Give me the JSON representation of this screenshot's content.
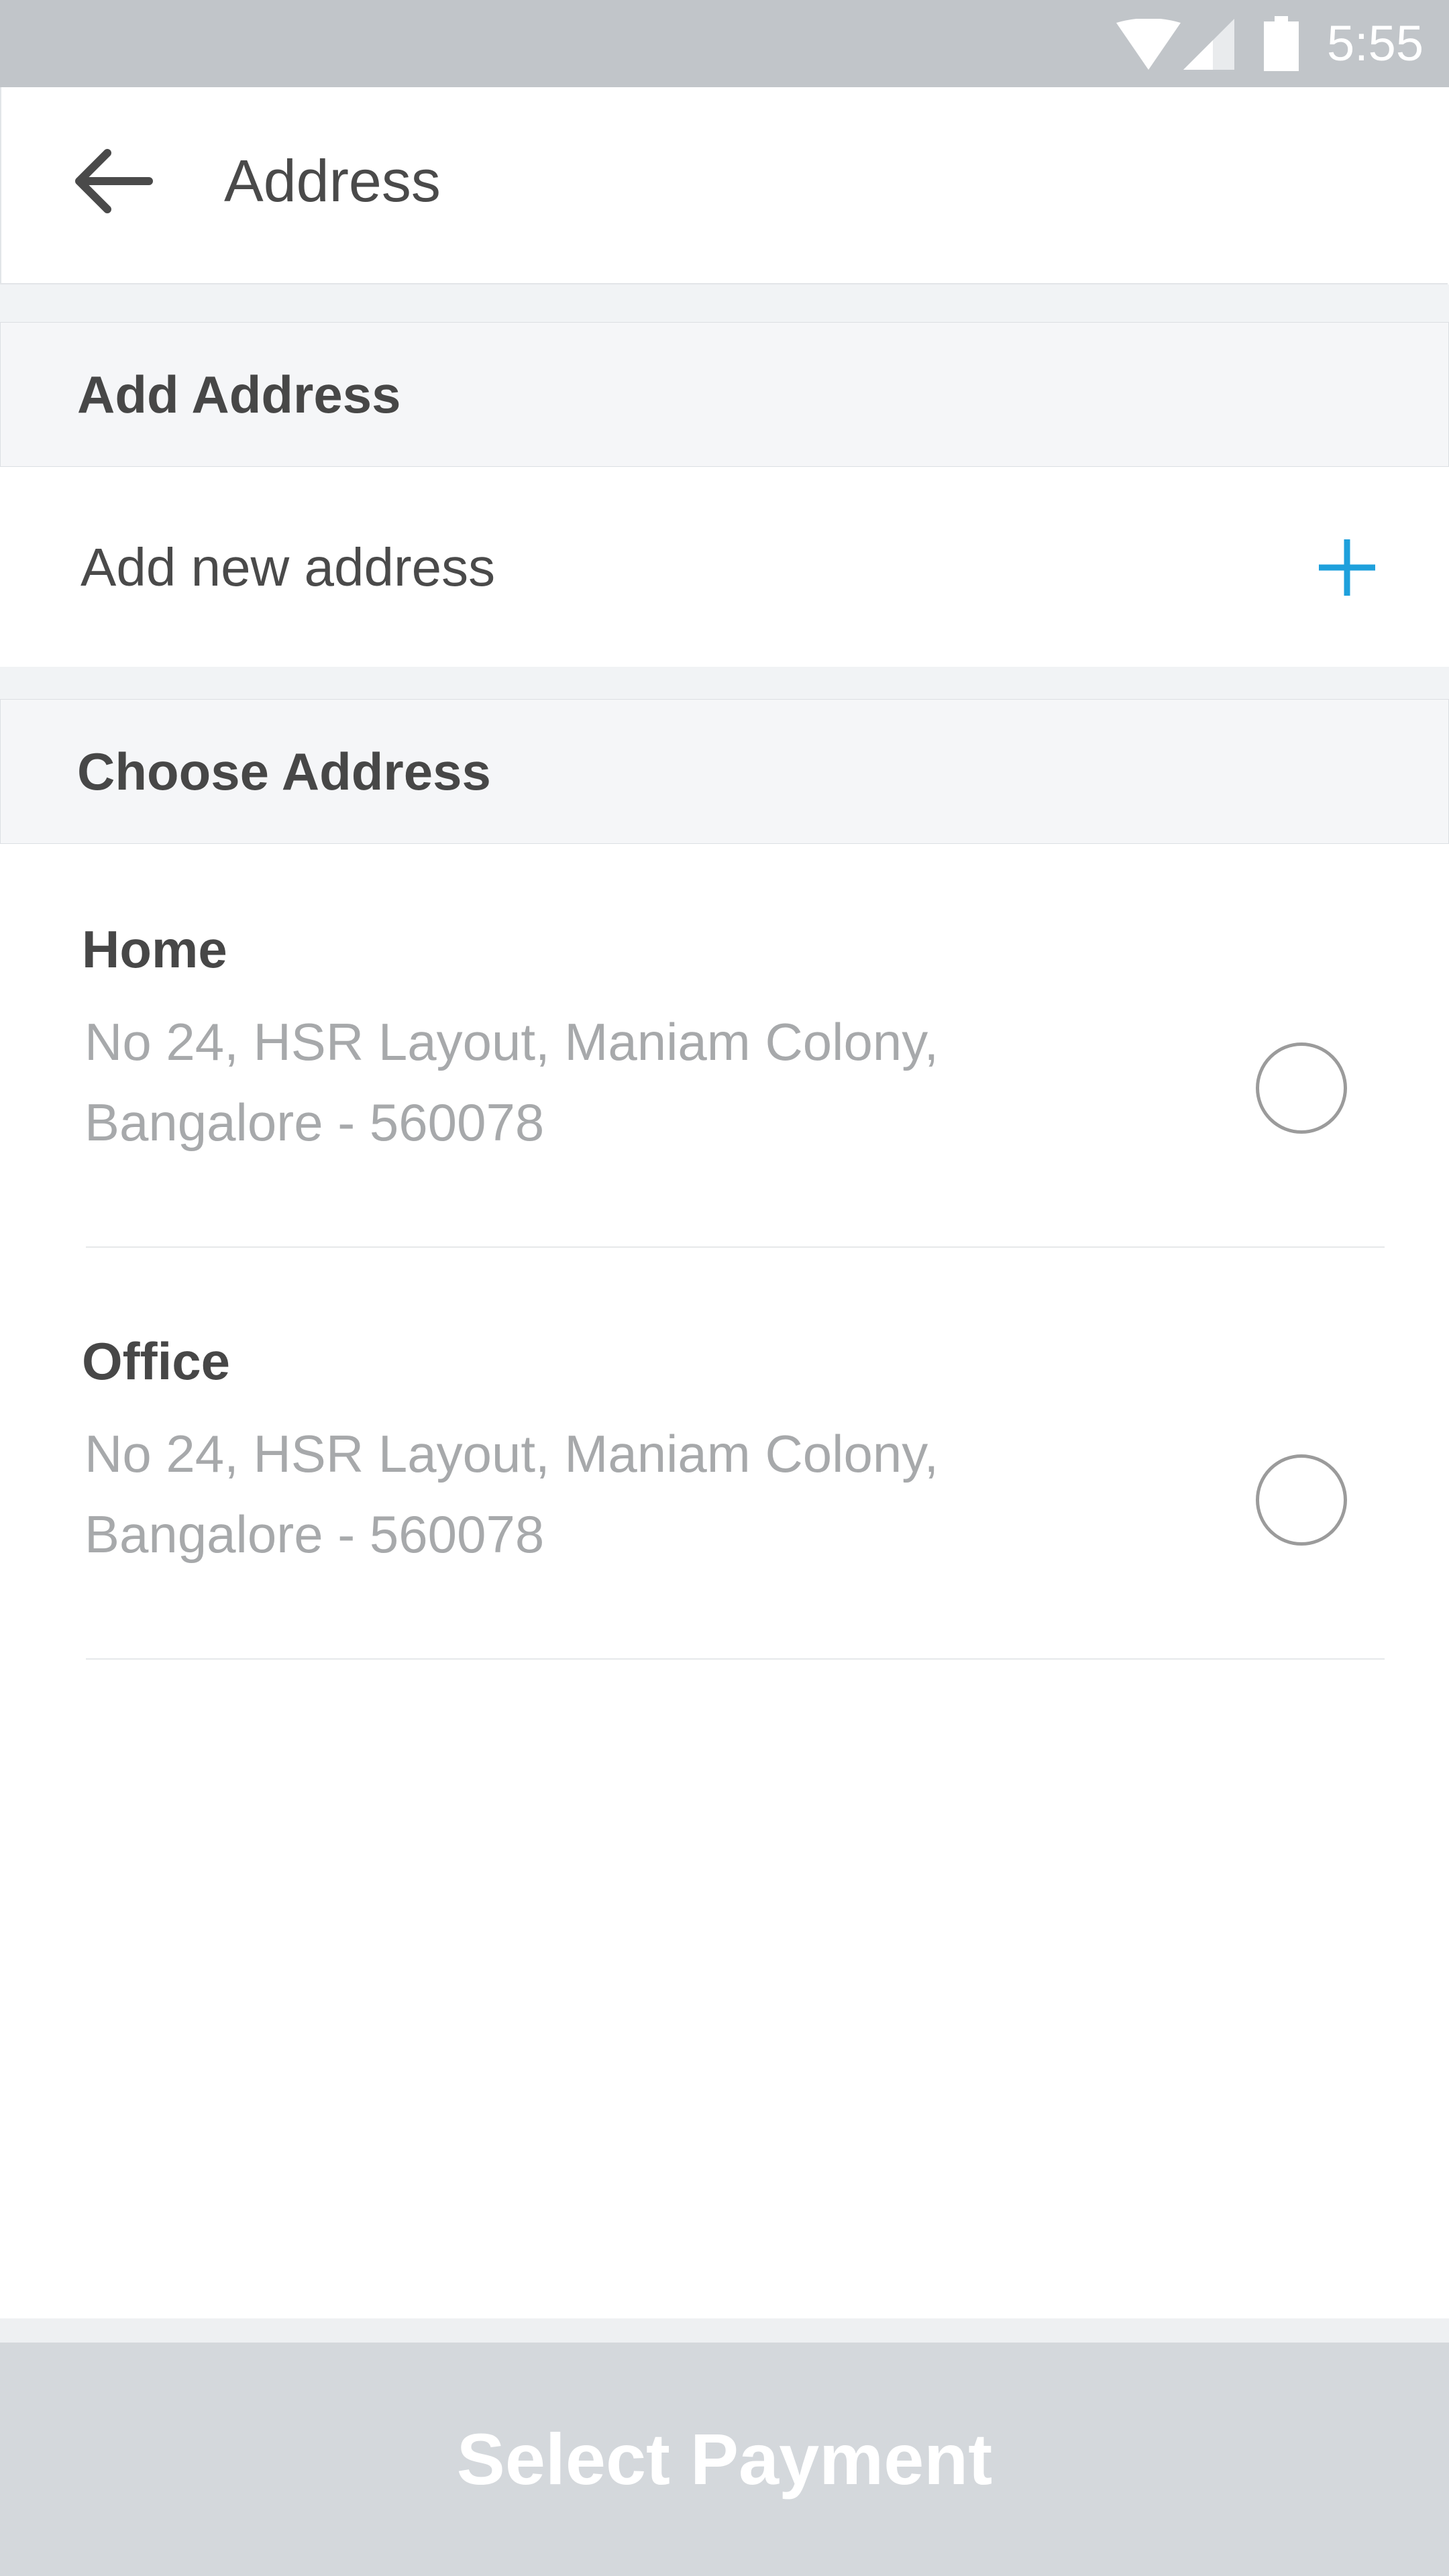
{
  "status_bar": {
    "time": "5:55",
    "icons": [
      "wifi-icon",
      "signal-icon",
      "battery-icon"
    ]
  },
  "header": {
    "back_icon": "arrow-left-icon",
    "title": "Address"
  },
  "add_section": {
    "title": "Add Address",
    "add_row_label": "Add new address",
    "add_icon": "plus-icon",
    "accent_color": "#1ea0dc"
  },
  "choose_section": {
    "title": "Choose Address",
    "addresses": [
      {
        "name": "Home",
        "line1": "No 24, HSR Layout, Maniam Colony,",
        "line2": "Bangalore - 560078",
        "selected": false
      },
      {
        "name": "Office",
        "line1": "No 24, HSR Layout, Maniam Colony,",
        "line2": "Bangalore - 560078",
        "selected": false
      }
    ]
  },
  "footer": {
    "button_label": "Select Payment",
    "button_color": "#d4d8dc"
  }
}
